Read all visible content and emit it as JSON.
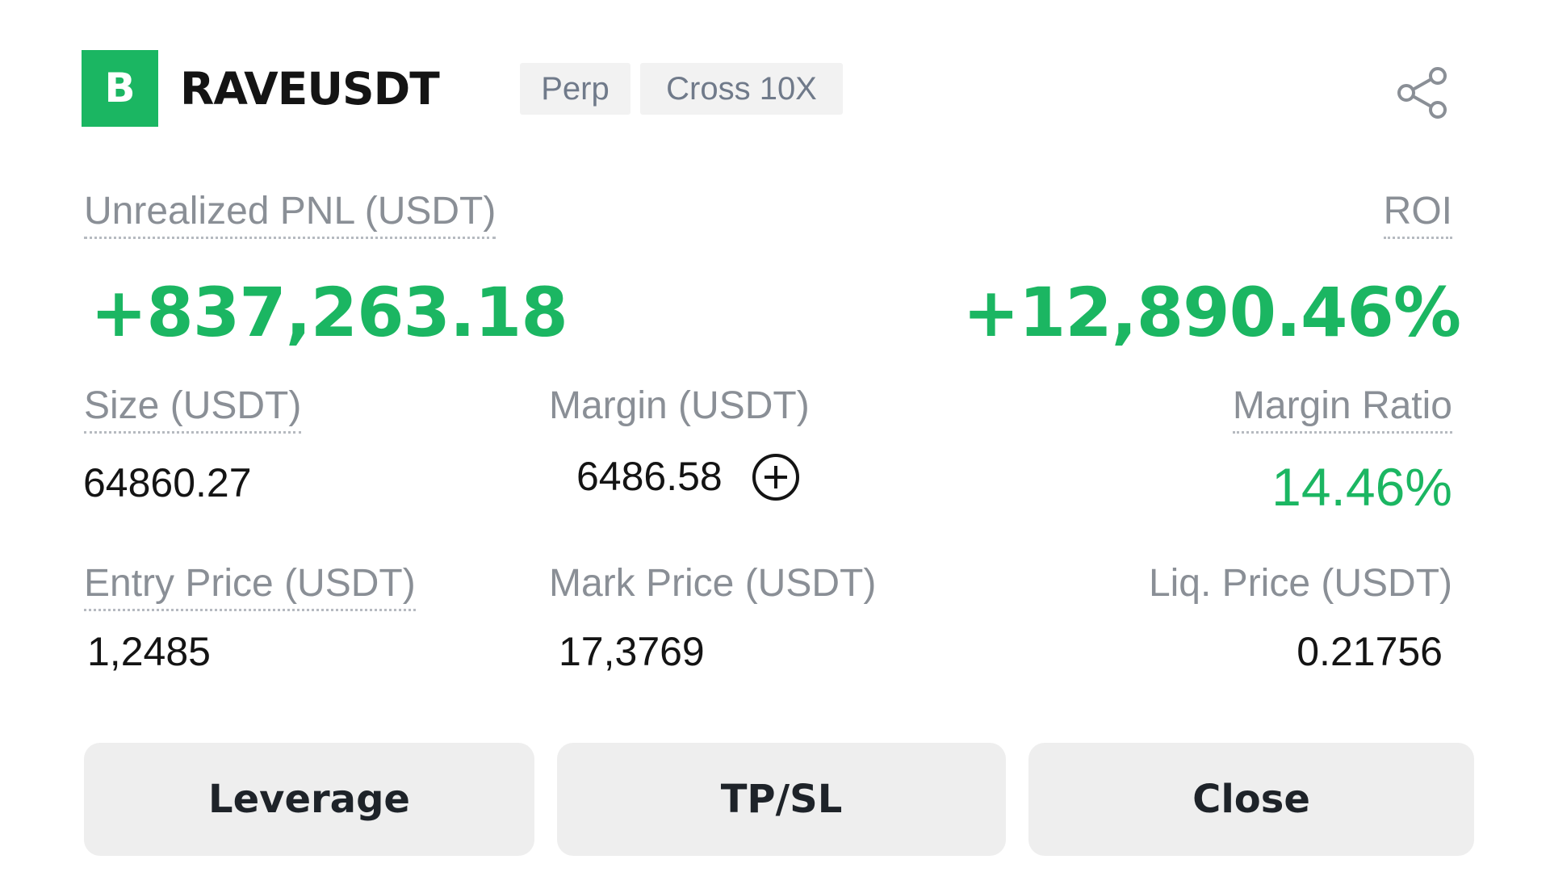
{
  "header": {
    "badge": "B",
    "symbol": "RAVEUSDT",
    "tags": [
      "Perp",
      "Cross 10X"
    ]
  },
  "pnl": {
    "label": "Unrealized PNL (USDT)",
    "value": "+837,263.18"
  },
  "roi": {
    "label": "ROI",
    "value": "+12,890.46%"
  },
  "size": {
    "label": "Size (USDT)",
    "value": "64860.27"
  },
  "margin": {
    "label": "Margin (USDT)",
    "value": "6486.58"
  },
  "margin_ratio": {
    "label": "Margin Ratio",
    "value": "14.46%"
  },
  "entry_price": {
    "label": "Entry Price (USDT)",
    "value": "1,2485"
  },
  "mark_price": {
    "label": "Mark Price (USDT)",
    "value": "17,3769"
  },
  "liq_price": {
    "label": "Liq. Price (USDT)",
    "value": "0.21756"
  },
  "buttons": {
    "leverage": "Leverage",
    "tpsl": "TP/SL",
    "close": "Close"
  },
  "icons": {
    "share": "share-icon",
    "add_margin": "plus-circle-icon"
  },
  "colors": {
    "positive": "#1bb662",
    "badge": "#1bb662",
    "label": "#8a8f96",
    "button_bg": "#eeeeee"
  }
}
